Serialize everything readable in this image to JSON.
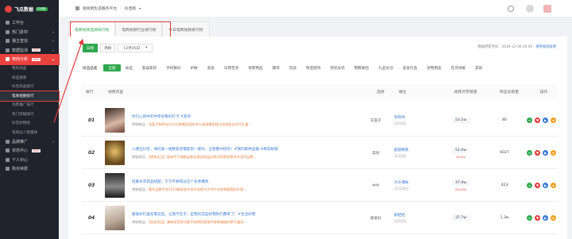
{
  "brand": {
    "name": "飞瓜数据",
    "badge": "抖音版"
  },
  "sidebar": {
    "items": [
      {
        "label": "工作台",
        "icon": "desk-icon"
      },
      {
        "label": "热门素材",
        "icon": "fire-icon"
      },
      {
        "label": "播主查找",
        "icon": "user-icon"
      },
      {
        "label": "数据监测",
        "icon": "monitor-icon",
        "badge": "NEW"
      },
      {
        "label": "电商分析",
        "icon": "cart-icon",
        "badge": "NEW",
        "active": true
      }
    ],
    "sub_items": [
      {
        "label": "我的商品"
      },
      {
        "label": "商品搜索"
      },
      {
        "label": "抖音商品排行"
      },
      {
        "label": "电商视频排行",
        "active": true
      },
      {
        "label": "淘客推广排行"
      },
      {
        "label": "热门商铺排行"
      },
      {
        "label": "抖音好物榜"
      },
      {
        "label": "电商达人销量榜"
      }
    ],
    "bottom_items": [
      {
        "label": "品牌推广",
        "icon": "brand-icon"
      },
      {
        "label": "状态中心",
        "icon": "status-icon",
        "badge": "NEW"
      },
      {
        "label": "个人中心",
        "icon": "person-icon"
      },
      {
        "label": "购买续费",
        "icon": "pay-icon"
      }
    ]
  },
  "topbar": {
    "platform": "短视频生态服务平台",
    "product": "抖音版"
  },
  "tabs": [
    "电商视频品牌排行榜",
    "电商视频行业排行榜",
    "今日电商视频排行榜"
  ],
  "filter": {
    "day_label": "日榜",
    "week_label": "周榜",
    "date": "12月05日",
    "update_note": "数据更新时间：2019-12-06 04:00",
    "explain_link": "榜单规则说明"
  },
  "categories": {
    "label": "商品品类",
    "items": [
      "全部",
      "食品",
      "家居家纺",
      "手机数码",
      "护肤",
      "美妆",
      "日用百货",
      "母婴用品",
      "服饰",
      "玩具",
      "珠宝配饰",
      "男装女装",
      "鞋靴箱包",
      "礼品文创",
      "美食饮品",
      "宠物用品",
      "花鸟绿植",
      "其他"
    ]
  },
  "table": {
    "headers": [
      "排行",
      "视频内容",
      "品牌",
      "播主",
      "视频点赞增量",
      "商品总销量",
      "操作"
    ],
    "rows": [
      {
        "rank": "01",
        "title": "你们心目中的中年好看的打卡 #家有",
        "goods_label": "关联商品：",
        "goods": "花荟子新款宝贝口红唇膏保湿女持久滋润雾面哑光丝绒显白学生礼盒...",
        "brand": "花荟子",
        "author": "等到你",
        "time": "12月3日",
        "likes": "53.1w",
        "likes_change": "",
        "sales": "80"
      },
      {
        "rank": "02",
        "title": "火爆全抖音，果的第一拨整套买都复刻一套的，全套都中招的！#我的家养盆栽 #梅花眼镜",
        "goods_label": "关联商品：",
        "goods": "【原装正品】园林手写绿植盆栽买就送花盆好养活四季常青花卉室内盆景...",
        "brand": "其他",
        "author": "超级精英",
        "time": "12月3日",
        "likes": "51.0w",
        "likes_change": "45.5%",
        "sales": "6027"
      },
      {
        "rank": "03",
        "title": "轻奢冬衣新品搭配，千万不要错过这个冬季爆款",
        "goods_label": "关联商品：",
        "goods": "奢华品牌大衣2019新款女冬季羊毛呢子大衣中长款韩版宽松外套...",
        "brand": "中牛",
        "author": "大头博妹",
        "time": "11月29日",
        "likes": "37.9w",
        "likes_change": "254.8%",
        "sales": "423"
      },
      {
        "rank": "04",
        "title": "康爱好们喜欢看这些，让我不在乎，是我的这些好物你们都来了！#生活好物",
        "goods_label": "关联商品：",
        "goods": "【厨具用品】美味家用多功能不粘锅炒菜锅平底锅电磁炉燃气通用...",
        "brand": "康爱好",
        "author": "聪娃娃",
        "time": "12月3日",
        "likes": "37.7w",
        "likes_change": "",
        "sales": "1.3w"
      }
    ]
  },
  "colors": {
    "accent": "#2fa84f",
    "highlight": "#e23b3b",
    "sidebar_bg": "#20232b"
  }
}
